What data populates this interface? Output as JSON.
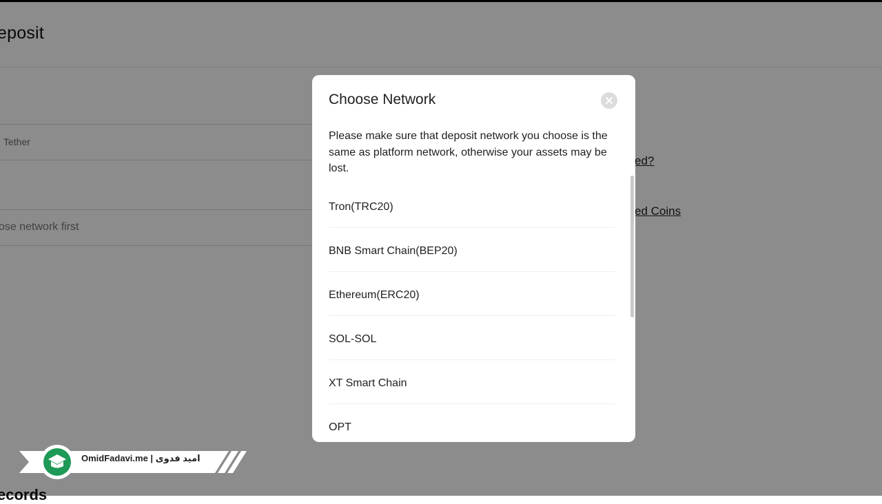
{
  "page": {
    "title": "eposit",
    "coin_name": "Tether",
    "network_placeholder": "ose network first",
    "links": [
      "ed?",
      "ed Coins"
    ],
    "records_heading": "ecords"
  },
  "modal": {
    "title": "Choose Network",
    "warning": "Please make sure that deposit network you choose is the same as platform network, otherwise your assets may be lost.",
    "networks": [
      "Tron(TRC20)",
      "BNB Smart Chain(BEP20)",
      "Ethereum(ERC20)",
      "SOL-SOL",
      "XT Smart Chain",
      "OPT"
    ]
  },
  "watermark": {
    "text": "OmidFadavi.me  |  امید فدوی"
  },
  "colors": {
    "overlay": "rgba(0,0,0,0.45)",
    "modal_bg": "#ffffff",
    "watermark_green": "#1f9a56"
  }
}
